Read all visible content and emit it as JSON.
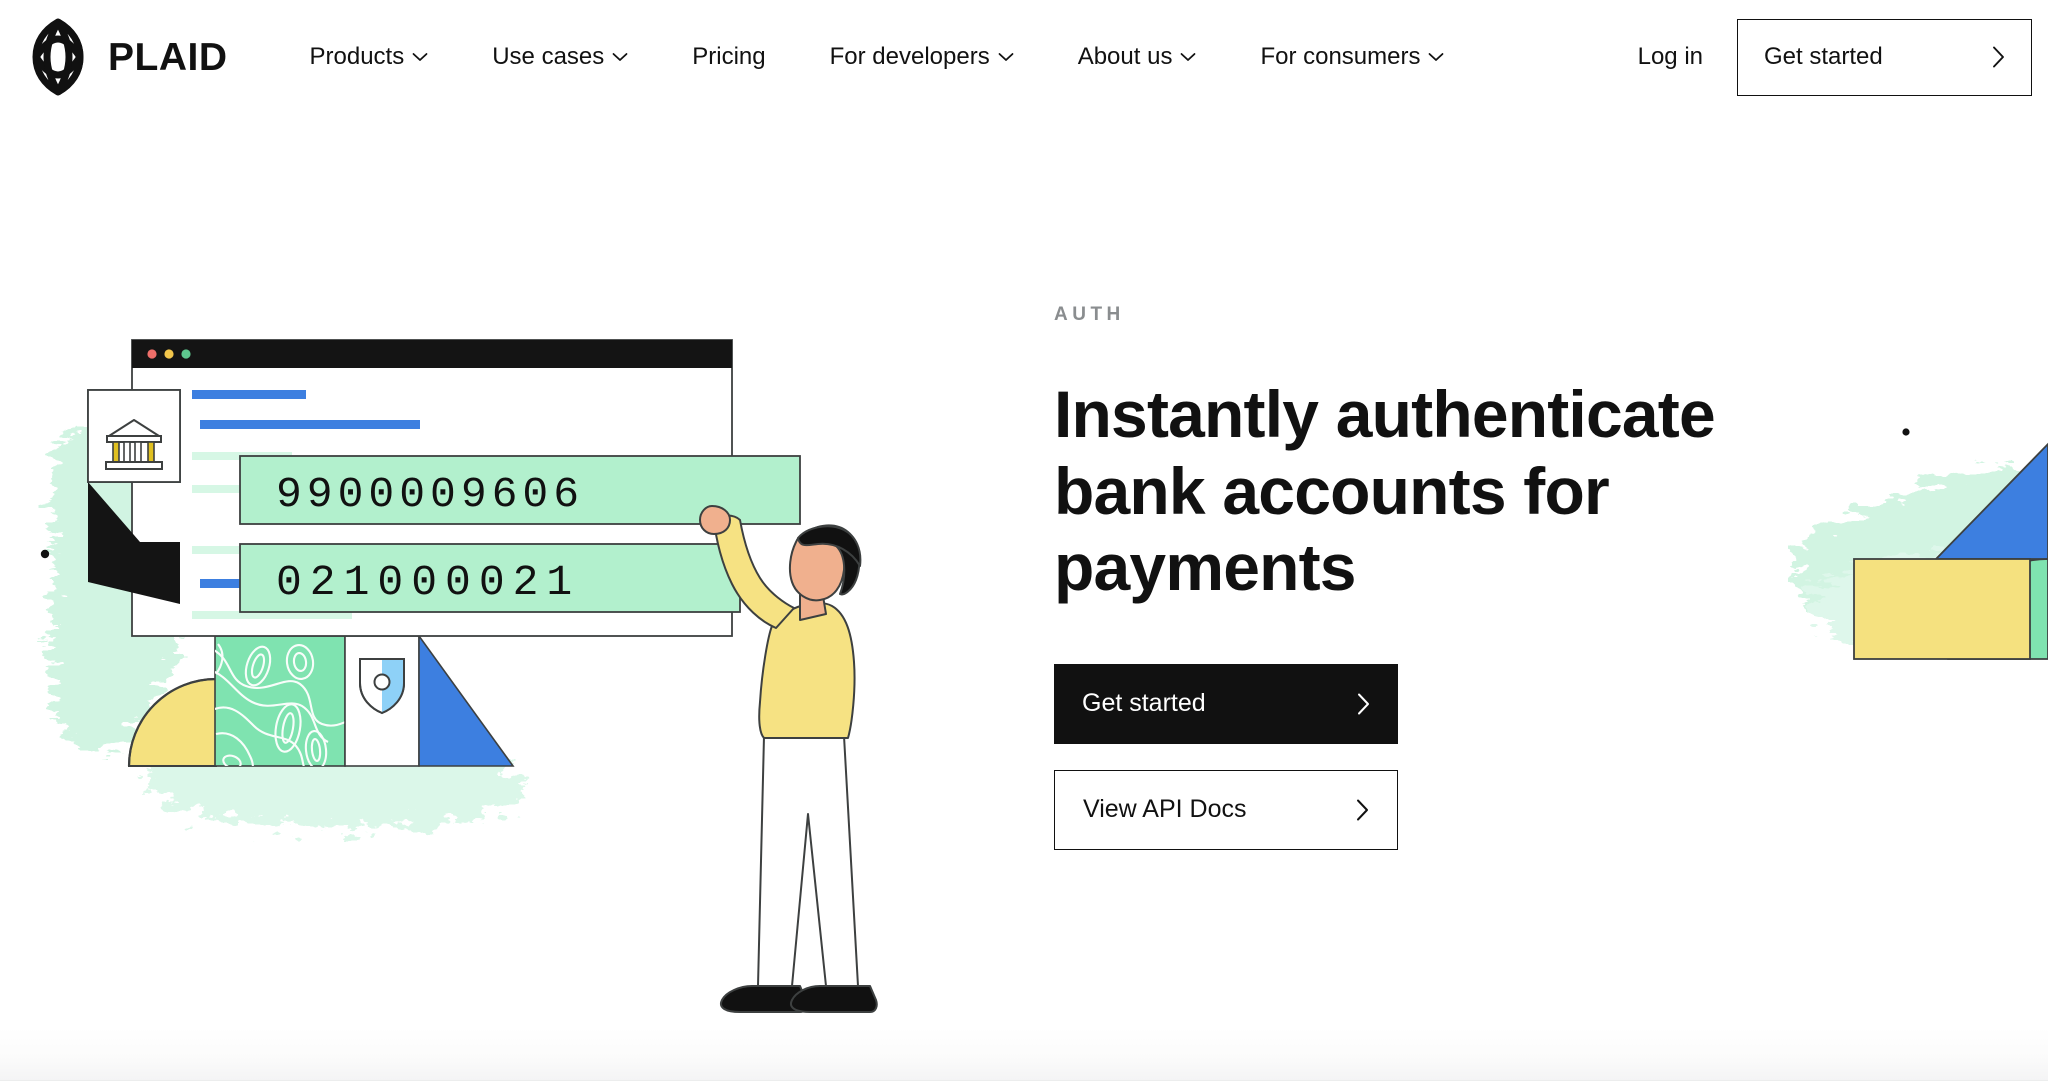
{
  "brand": {
    "name": "PLAID",
    "logo_icon": "plaid-lattice-logo"
  },
  "nav": {
    "items": [
      {
        "label": "Products",
        "has_dropdown": true
      },
      {
        "label": "Use cases",
        "has_dropdown": true
      },
      {
        "label": "Pricing",
        "has_dropdown": false
      },
      {
        "label": "For developers",
        "has_dropdown": true
      },
      {
        "label": "About us",
        "has_dropdown": true
      },
      {
        "label": "For consumers",
        "has_dropdown": true
      }
    ],
    "login_label": "Log in",
    "cta_label": "Get started",
    "cta_icon": "chevron-right-icon"
  },
  "hero": {
    "eyebrow": "AUTH",
    "headline": "Instantly authenticate bank accounts for payments",
    "primary_cta": {
      "label": "Get started",
      "icon": "chevron-right-icon"
    },
    "secondary_cta": {
      "label": "View API Docs",
      "icon": "chevron-right-icon"
    }
  },
  "illustration": {
    "browser_window": {
      "traffic_lights": [
        "red",
        "yellow",
        "green"
      ]
    },
    "bank_card_icon": "bank-building-icon",
    "shield_card_icon": "shield-check-icon",
    "account_number": "9900009606",
    "routing_number": "021000021",
    "person": "person-reaching-up"
  },
  "colors": {
    "ink": "#111111",
    "blue": "#3d7fe0",
    "mint": "#b2f0cd",
    "mint_pale": "#d6f7e5",
    "topo_green": "#7fe3b0",
    "yellow": "#f5e17f",
    "sweater_yellow": "#f6e283",
    "skin": "#f0b08e",
    "shield_blue": "#8ed1f7",
    "muted_text": "#8a8d8f"
  }
}
